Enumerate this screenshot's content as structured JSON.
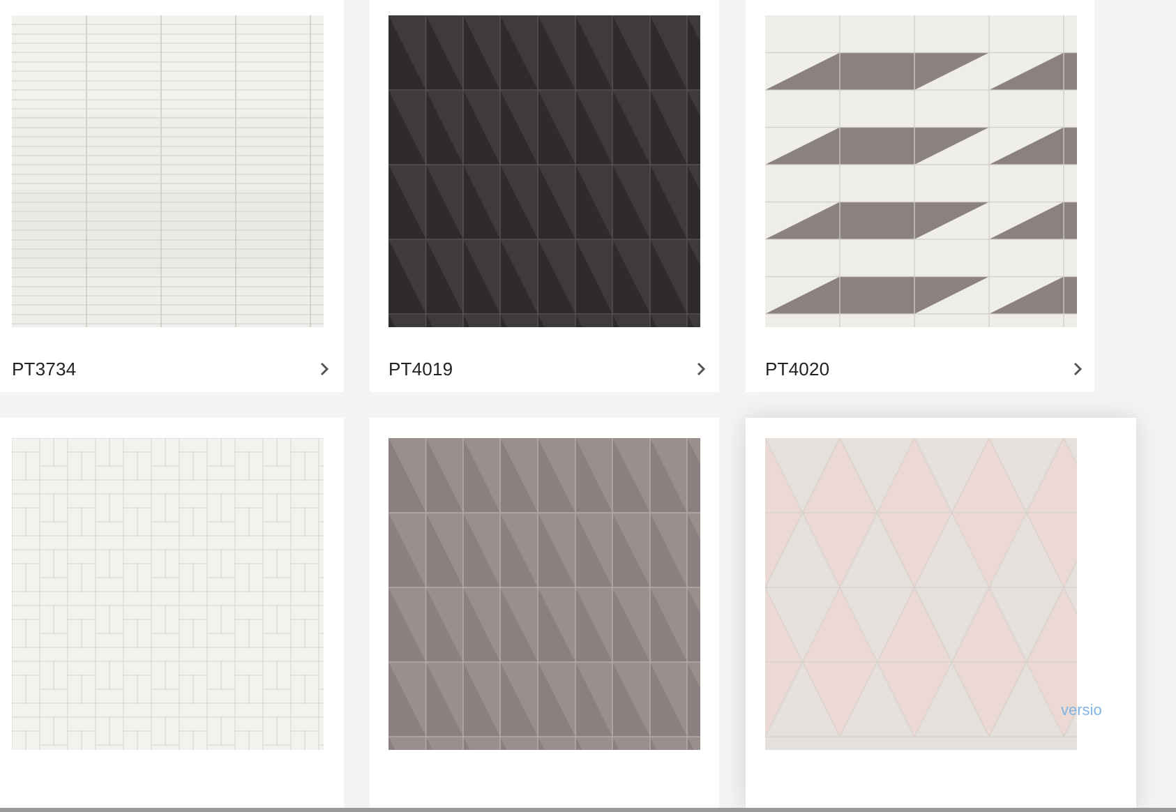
{
  "products": [
    {
      "code": "PT3734",
      "pattern": "white-linear-stack"
    },
    {
      "code": "PT4019",
      "pattern": "dark-diagonal"
    },
    {
      "code": "PT4020",
      "pattern": "white-brown-parallelogram"
    },
    {
      "code": "",
      "pattern": "white-herringbone"
    },
    {
      "code": "",
      "pattern": "grey-diagonal"
    },
    {
      "code": "",
      "pattern": "pink-triangle"
    }
  ],
  "icons": {
    "card_arrow": "chevron-right-icon"
  },
  "version_badge": "versio",
  "colors": {
    "page_bg": "#f4f4f4",
    "card_bg": "#ffffff",
    "caption_text": "#222222",
    "chevron": "#555555",
    "version_text": "#80b4e6"
  }
}
